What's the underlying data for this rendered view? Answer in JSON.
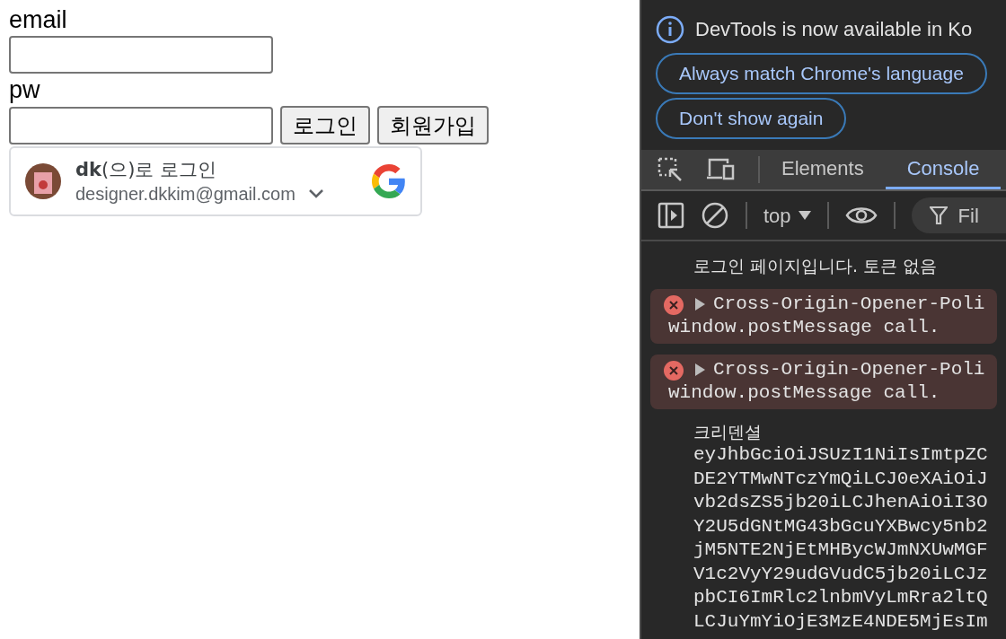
{
  "page": {
    "email_label": "email",
    "pw_label": "pw",
    "buttons": [
      "로그인",
      "회원가입"
    ],
    "google_signin": {
      "title": "**dk**(으)로 로그인",
      "email": "designer.dkkim@gmail.com"
    }
  },
  "devtools": {
    "infobar": {
      "message": "DevTools is now available in Ko",
      "actions": [
        "Always match Chrome's language",
        "Don't show again"
      ]
    },
    "tabs": [
      {
        "label": "Elements",
        "selected": false
      },
      {
        "label": "Console",
        "selected": true
      }
    ],
    "toolbar": {
      "context": "top",
      "filter": "Fil"
    },
    "messages": [
      {
        "kind": "log",
        "lines": [
          "로그인 페이지입니다. 토큰 없음"
        ]
      },
      {
        "kind": "error",
        "lines": [
          "Cross-Origin-Opener-Poli",
          "window.postMessage call."
        ]
      },
      {
        "kind": "error",
        "lines": [
          "Cross-Origin-Opener-Poli",
          "window.postMessage call."
        ]
      },
      {
        "kind": "log",
        "lines": [
          "크리덴셜",
          "eyJhbGciOiJSUzI1NiIsImtpZC",
          "DE2YTMwNTczYmQiLCJ0eXAiOiJ",
          "vb2dsZS5jb20iLCJhenAiOiI3O",
          "Y2U5dGNtMG43bGcuYXBwcy5nb2",
          "jM5NTE2NjEtMHBycWJmNXUwMGF",
          "V1c2VyY29udGVudC5jb20iLCJz",
          "pbCI6ImRlc2lnbmVyLmRra2ltQ",
          "LCJuYmYiOjE3MzE4NDE5MjEsIm"
        ]
      }
    ]
  }
}
